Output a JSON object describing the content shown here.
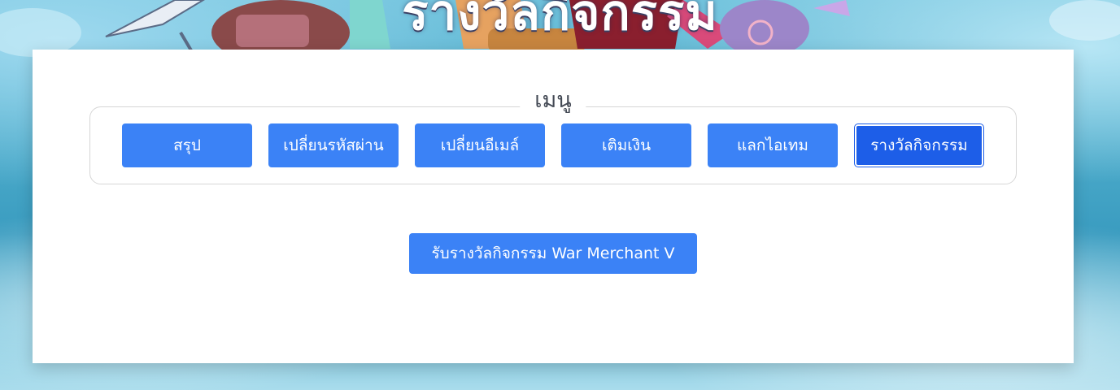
{
  "header": {
    "title": "รางวัลกิจกรรม"
  },
  "menu": {
    "legend": "เมนู",
    "items": [
      {
        "label": "สรุป",
        "active": false
      },
      {
        "label": "เปลี่ยนรหัสผ่าน",
        "active": false
      },
      {
        "label": "เปลี่ยนอีเมล์",
        "active": false
      },
      {
        "label": "เติมเงิน",
        "active": false
      },
      {
        "label": "แลกไอเทม",
        "active": false
      },
      {
        "label": "รางวัลกิจกรรม",
        "active": true
      }
    ]
  },
  "reward": {
    "button_label": "รับรางวัลกิจกรรม War Merchant V"
  },
  "colors": {
    "button": "#3b82f6",
    "button_active": "#1d5ee8",
    "panel": "#ffffff"
  }
}
